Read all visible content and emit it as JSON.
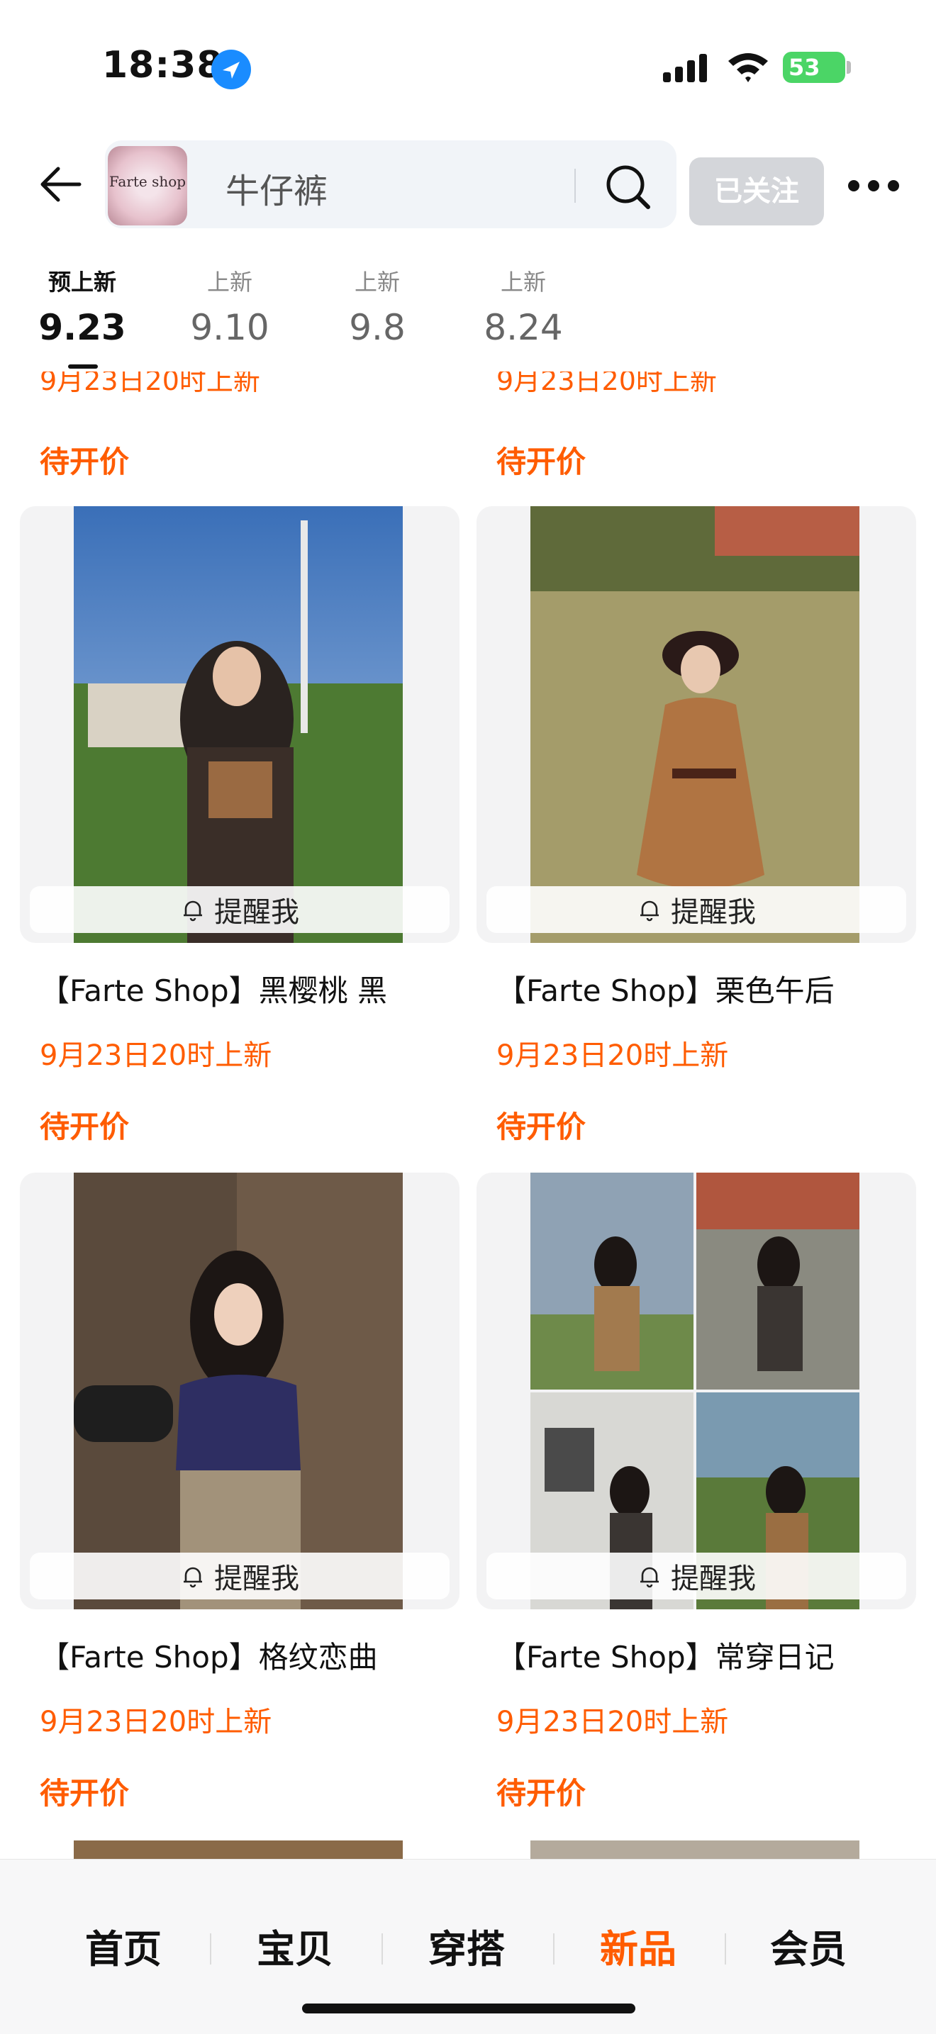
{
  "status_bar": {
    "time": "18:38",
    "battery": "53"
  },
  "header": {
    "logo_text": "Farte shop",
    "search_text": "牛仔裤",
    "follow_label": "已关注"
  },
  "date_tabs": [
    {
      "label": "预上新",
      "date": "9.23",
      "active": true
    },
    {
      "label": "上新",
      "date": "9.10",
      "active": false
    },
    {
      "label": "上新",
      "date": "9.8",
      "active": false
    },
    {
      "label": "上新",
      "date": "8.24",
      "active": false
    }
  ],
  "prev_row": {
    "left": {
      "date": "9月23日20时上新",
      "price": "待开价"
    },
    "right": {
      "date": "9月23日20时上新",
      "price": "待开价"
    }
  },
  "products": [
    {
      "title": "【Farte Shop】黑樱桃 黑",
      "date": "9月23日20时上新",
      "price": "待开价",
      "remind": "提醒我"
    },
    {
      "title": "【Farte Shop】栗色午后",
      "date": "9月23日20时上新",
      "price": "待开价",
      "remind": "提醒我"
    },
    {
      "title": "【Farte Shop】格纹恋曲",
      "date": "9月23日20时上新",
      "price": "待开价",
      "remind": "提醒我"
    },
    {
      "title": "【Farte Shop】常穿日记",
      "date": "9月23日20时上新",
      "price": "待开价",
      "remind": "提醒我"
    }
  ],
  "bottom_nav": [
    {
      "label": "首页",
      "active": false
    },
    {
      "label": "宝贝",
      "active": false
    },
    {
      "label": "穿搭",
      "active": false
    },
    {
      "label": "新品",
      "active": true
    },
    {
      "label": "会员",
      "active": false
    }
  ],
  "colors": {
    "accent": "#ff5c00",
    "battery": "#4bd566",
    "location": "#1a8cff"
  }
}
